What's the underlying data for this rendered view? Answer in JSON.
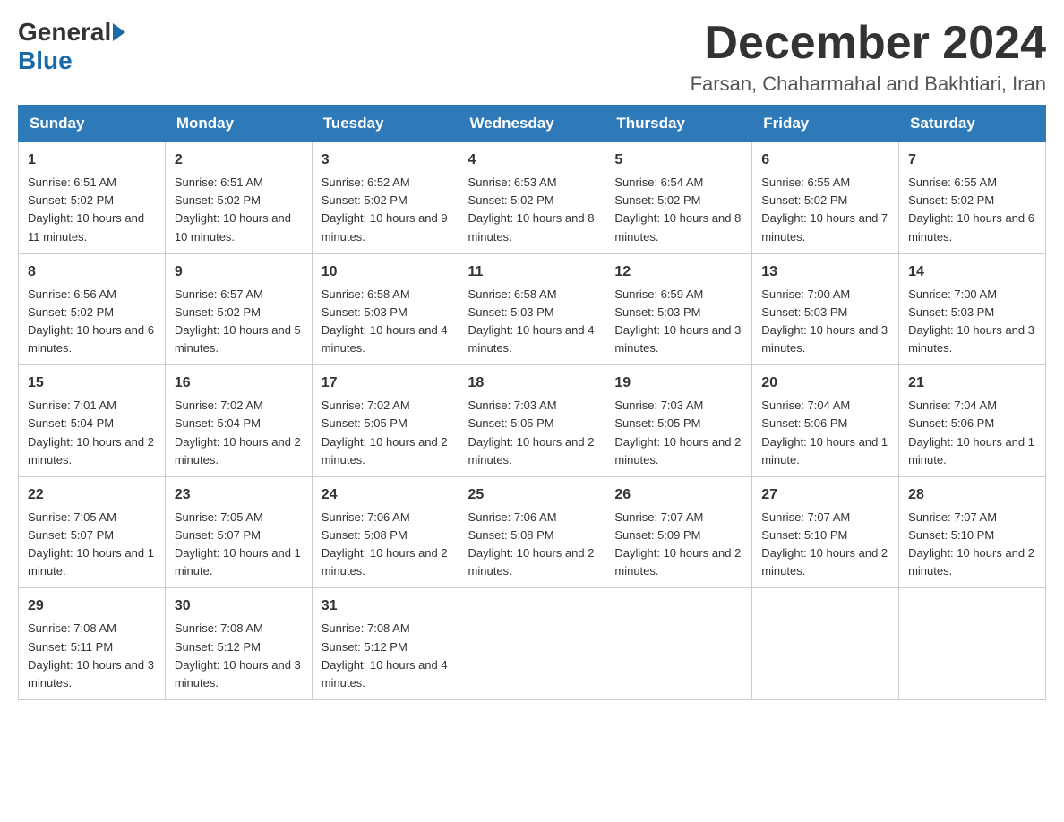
{
  "logo": {
    "general": "General",
    "blue": "Blue"
  },
  "header": {
    "month_title": "December 2024",
    "subtitle": "Farsan, Chaharmahal and Bakhtiari, Iran"
  },
  "days_of_week": [
    "Sunday",
    "Monday",
    "Tuesday",
    "Wednesday",
    "Thursday",
    "Friday",
    "Saturday"
  ],
  "weeks": [
    [
      {
        "day": "1",
        "sunrise": "6:51 AM",
        "sunset": "5:02 PM",
        "daylight": "10 hours and 11 minutes."
      },
      {
        "day": "2",
        "sunrise": "6:51 AM",
        "sunset": "5:02 PM",
        "daylight": "10 hours and 10 minutes."
      },
      {
        "day": "3",
        "sunrise": "6:52 AM",
        "sunset": "5:02 PM",
        "daylight": "10 hours and 9 minutes."
      },
      {
        "day": "4",
        "sunrise": "6:53 AM",
        "sunset": "5:02 PM",
        "daylight": "10 hours and 8 minutes."
      },
      {
        "day": "5",
        "sunrise": "6:54 AM",
        "sunset": "5:02 PM",
        "daylight": "10 hours and 8 minutes."
      },
      {
        "day": "6",
        "sunrise": "6:55 AM",
        "sunset": "5:02 PM",
        "daylight": "10 hours and 7 minutes."
      },
      {
        "day": "7",
        "sunrise": "6:55 AM",
        "sunset": "5:02 PM",
        "daylight": "10 hours and 6 minutes."
      }
    ],
    [
      {
        "day": "8",
        "sunrise": "6:56 AM",
        "sunset": "5:02 PM",
        "daylight": "10 hours and 6 minutes."
      },
      {
        "day": "9",
        "sunrise": "6:57 AM",
        "sunset": "5:02 PM",
        "daylight": "10 hours and 5 minutes."
      },
      {
        "day": "10",
        "sunrise": "6:58 AM",
        "sunset": "5:03 PM",
        "daylight": "10 hours and 4 minutes."
      },
      {
        "day": "11",
        "sunrise": "6:58 AM",
        "sunset": "5:03 PM",
        "daylight": "10 hours and 4 minutes."
      },
      {
        "day": "12",
        "sunrise": "6:59 AM",
        "sunset": "5:03 PM",
        "daylight": "10 hours and 3 minutes."
      },
      {
        "day": "13",
        "sunrise": "7:00 AM",
        "sunset": "5:03 PM",
        "daylight": "10 hours and 3 minutes."
      },
      {
        "day": "14",
        "sunrise": "7:00 AM",
        "sunset": "5:03 PM",
        "daylight": "10 hours and 3 minutes."
      }
    ],
    [
      {
        "day": "15",
        "sunrise": "7:01 AM",
        "sunset": "5:04 PM",
        "daylight": "10 hours and 2 minutes."
      },
      {
        "day": "16",
        "sunrise": "7:02 AM",
        "sunset": "5:04 PM",
        "daylight": "10 hours and 2 minutes."
      },
      {
        "day": "17",
        "sunrise": "7:02 AM",
        "sunset": "5:05 PM",
        "daylight": "10 hours and 2 minutes."
      },
      {
        "day": "18",
        "sunrise": "7:03 AM",
        "sunset": "5:05 PM",
        "daylight": "10 hours and 2 minutes."
      },
      {
        "day": "19",
        "sunrise": "7:03 AM",
        "sunset": "5:05 PM",
        "daylight": "10 hours and 2 minutes."
      },
      {
        "day": "20",
        "sunrise": "7:04 AM",
        "sunset": "5:06 PM",
        "daylight": "10 hours and 1 minute."
      },
      {
        "day": "21",
        "sunrise": "7:04 AM",
        "sunset": "5:06 PM",
        "daylight": "10 hours and 1 minute."
      }
    ],
    [
      {
        "day": "22",
        "sunrise": "7:05 AM",
        "sunset": "5:07 PM",
        "daylight": "10 hours and 1 minute."
      },
      {
        "day": "23",
        "sunrise": "7:05 AM",
        "sunset": "5:07 PM",
        "daylight": "10 hours and 1 minute."
      },
      {
        "day": "24",
        "sunrise": "7:06 AM",
        "sunset": "5:08 PM",
        "daylight": "10 hours and 2 minutes."
      },
      {
        "day": "25",
        "sunrise": "7:06 AM",
        "sunset": "5:08 PM",
        "daylight": "10 hours and 2 minutes."
      },
      {
        "day": "26",
        "sunrise": "7:07 AM",
        "sunset": "5:09 PM",
        "daylight": "10 hours and 2 minutes."
      },
      {
        "day": "27",
        "sunrise": "7:07 AM",
        "sunset": "5:10 PM",
        "daylight": "10 hours and 2 minutes."
      },
      {
        "day": "28",
        "sunrise": "7:07 AM",
        "sunset": "5:10 PM",
        "daylight": "10 hours and 2 minutes."
      }
    ],
    [
      {
        "day": "29",
        "sunrise": "7:08 AM",
        "sunset": "5:11 PM",
        "daylight": "10 hours and 3 minutes."
      },
      {
        "day": "30",
        "sunrise": "7:08 AM",
        "sunset": "5:12 PM",
        "daylight": "10 hours and 3 minutes."
      },
      {
        "day": "31",
        "sunrise": "7:08 AM",
        "sunset": "5:12 PM",
        "daylight": "10 hours and 4 minutes."
      },
      null,
      null,
      null,
      null
    ]
  ]
}
